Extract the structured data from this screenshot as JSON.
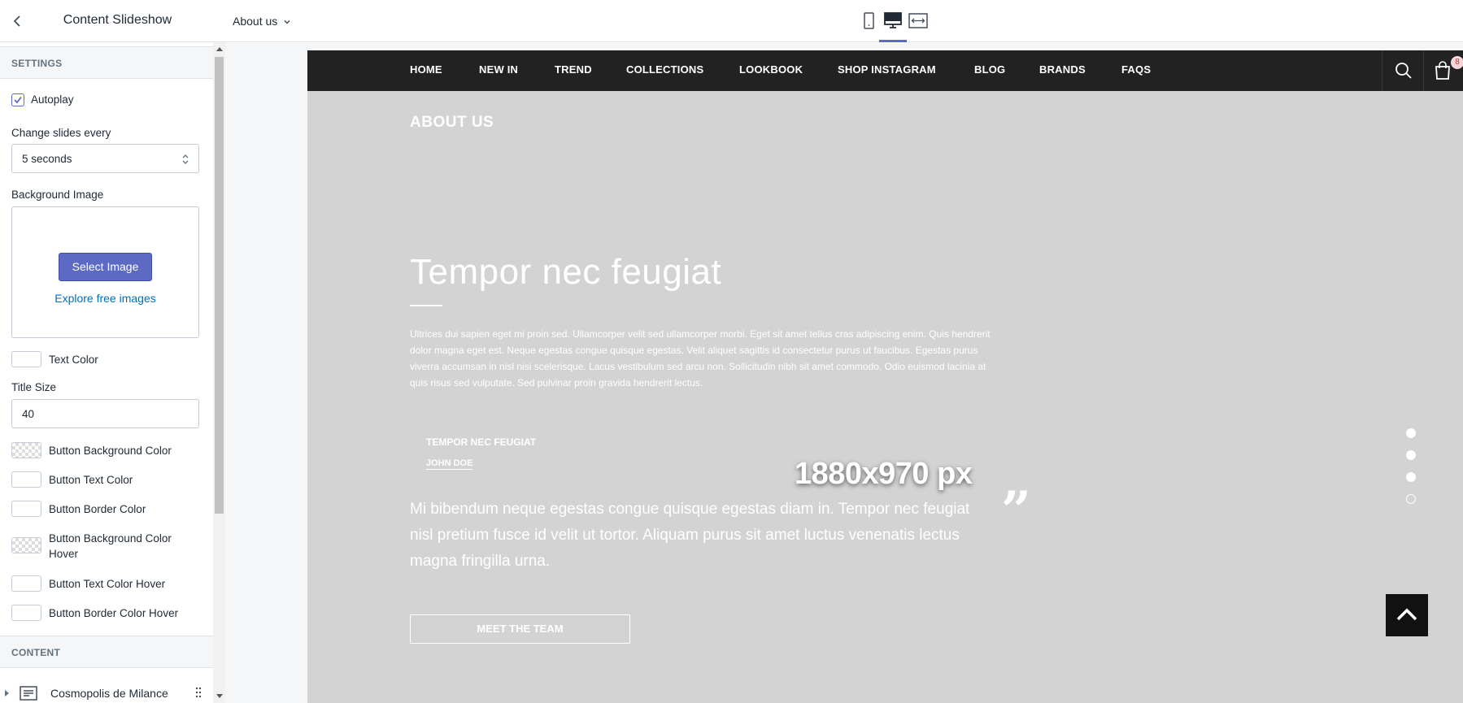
{
  "sidebar": {
    "title": "Content Slideshow",
    "settings_heading": "SETTINGS",
    "autoplay_label": "Autoplay",
    "change_slides_label": "Change slides every",
    "change_slides_value": "5 seconds",
    "background_image_label": "Background Image",
    "select_image_label": "Select Image",
    "explore_images_label": "Explore free images",
    "text_color_label": "Text Color",
    "title_size_label": "Title Size",
    "title_size_value": "40",
    "colors": [
      {
        "label": "Button Background Color",
        "pattern": "transparent"
      },
      {
        "label": "Button Text Color",
        "pattern": "white"
      },
      {
        "label": "Button Border Color",
        "pattern": "white"
      },
      {
        "label": "Button Background Color Hover",
        "pattern": "transparent"
      },
      {
        "label": "Button Text Color Hover",
        "pattern": "white"
      },
      {
        "label": "Button Border Color Hover",
        "pattern": "white"
      }
    ],
    "content_heading": "CONTENT",
    "block_label": "Cosmopolis de Milance"
  },
  "topbar": {
    "page_label": "About us"
  },
  "store": {
    "nav": [
      "HOME",
      "NEW IN",
      "TREND",
      "COLLECTIONS",
      "LOOKBOOK",
      "SHOP INSTAGRAM",
      "BLOG",
      "BRANDS",
      "FAQS"
    ],
    "cart_count": "8"
  },
  "slide": {
    "page_heading": "ABOUT US",
    "title": "Tempor nec feugiat",
    "body": "Ultrices dui sapien eget mi proin sed. Ullamcorper velit sed ullamcorper morbi. Eget sit amet tellus cras adipiscing enim. Quis hendrerit dolor magna eget est. Neque egestas congue quisque egestas. Velit aliquet sagittis id consectetur purus ut faucibus. Egestas purus viverra accumsan in nisl nisi scelerisque. Lacus vestibulum sed arcu non. Sollicitudin nibh sit amet commodo. Odio euismod lacinia at quis risus sed vulputate. Sed pulvinar proin gravida hendrerit lectus.",
    "quote_author_title": "TEMPOR NEC FEUGIAT",
    "quote_author_name": "JOHN DOE",
    "size_overlay": "1880x970 px",
    "quote_mark": "”",
    "quote": "Mi bibendum neque egestas congue quisque egestas diam in. Tempor nec feugiat nisl pretium fusce id velit ut tortor. Aliquam purus sit amet luctus venenatis lectus magna fringilla urna.",
    "cta_label": "MEET THE TEAM",
    "pager_dots": 4,
    "active_dot": 4
  },
  "colors": {
    "accent": "#5c6ac4",
    "link": "#006fbb",
    "slide_bg": "#d3d3d3",
    "nav_bg": "#222222"
  }
}
